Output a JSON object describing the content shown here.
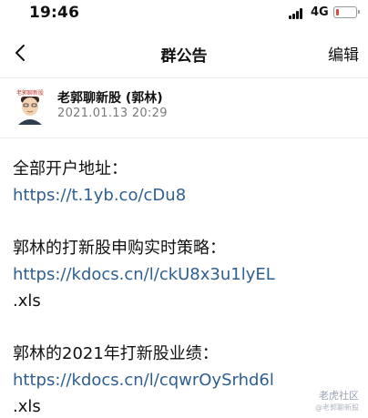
{
  "status_bar": {
    "time": "19:46",
    "network": "4G",
    "icons": [
      "signal-icon",
      "battery-icon"
    ],
    "battery_level": 0.15
  },
  "nav": {
    "title": "群公告",
    "back_icon": "chevron-left-icon",
    "edit_label": "编辑"
  },
  "author": {
    "name": "老郭聊新股 (郭林)",
    "time": "2021.01.13  20:29"
  },
  "announcement": {
    "section1_title": "全部开户地址：",
    "section1_link": "https://t.1yb.co/cDu8",
    "section2_title": "郭林的打新股申购实时策略：",
    "section2_link": "https://kdocs.cn/l/ckU8x3u1lyEL",
    "section2_link_suffix": ".xls",
    "section3_title": "郭林的2021年打新股业绩：",
    "section3_link": "https://kdocs.cn/l/cqwrOySrhd6l",
    "section3_link_suffix": ".xls"
  },
  "watermark": {
    "brand": "老虎社区",
    "sub": "@老郭聊新股"
  },
  "colors": {
    "link": "#2d5f91",
    "text": "#111111",
    "muted": "#7a7a7a",
    "divider": "#ececec",
    "battery_low": "#e0463a"
  }
}
